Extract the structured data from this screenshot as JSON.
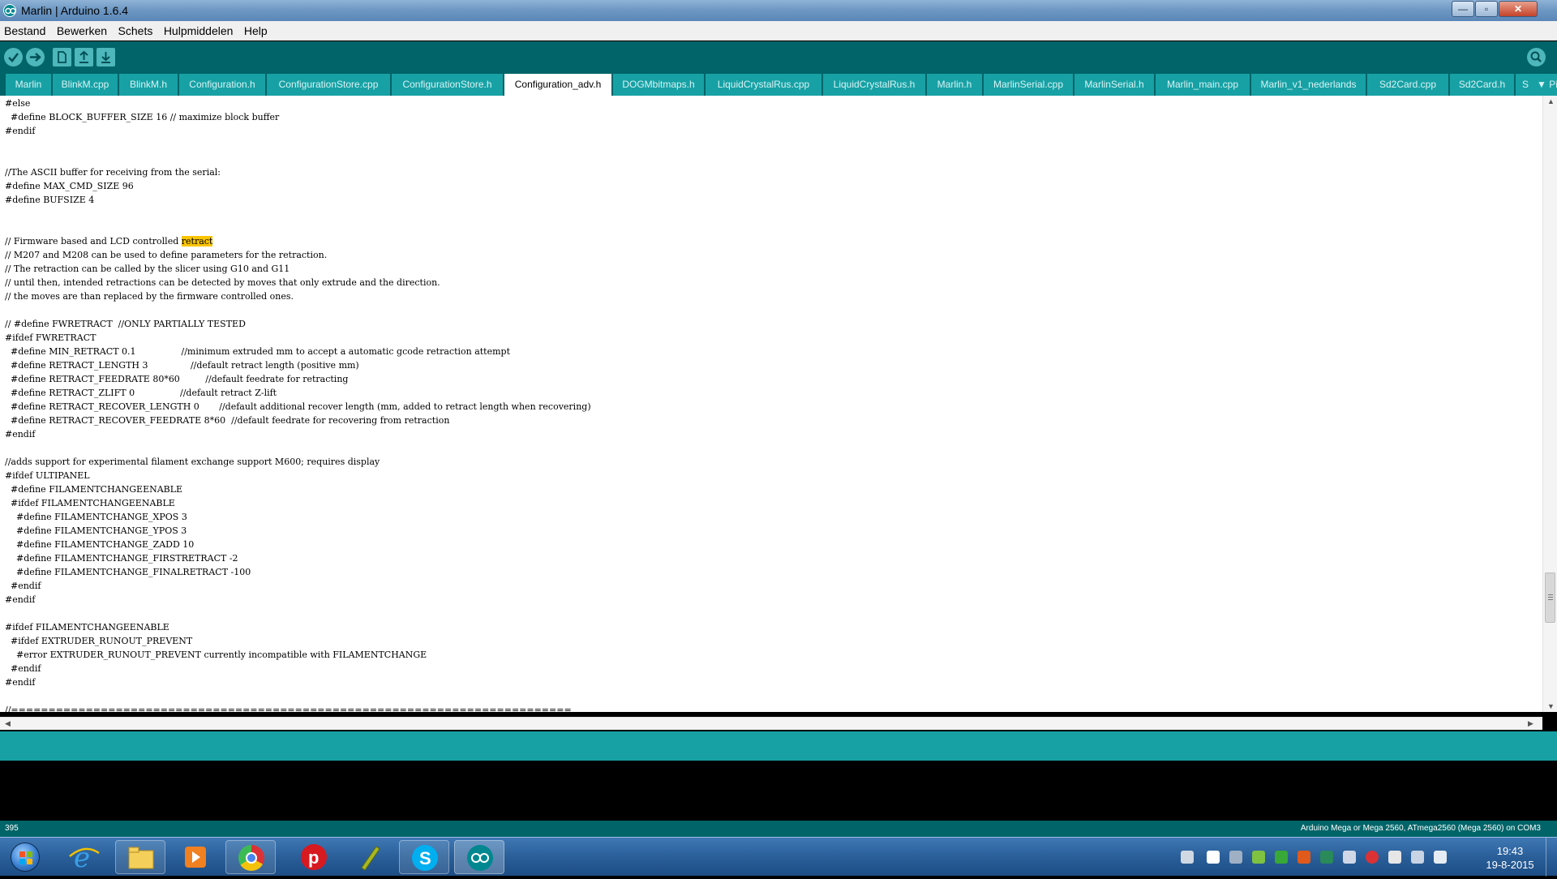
{
  "window": {
    "title": "Marlin | Arduino 1.6.4",
    "minimize": "—",
    "maximize": "▫",
    "close": "✕"
  },
  "menu": [
    "Bestand",
    "Bewerken",
    "Schets",
    "Hulpmiddelen",
    "Help"
  ],
  "toolbar": {
    "buttons": [
      "verify-icon",
      "upload-icon",
      "new-icon",
      "open-icon",
      "save-icon",
      "serial-monitor-icon"
    ],
    "accent": "#006468",
    "button_color": "#4db7bb"
  },
  "tabs": [
    "Marlin",
    "BlinkM.cpp",
    "BlinkM.h",
    "Configuration.h",
    "ConfigurationStore.cpp",
    "ConfigurationStore.h",
    "Configuration_adv.h",
    "DOGMbitmaps.h",
    "LiquidCrystalRus.cpp",
    "LiquidCrystalRus.h",
    "Marlin.h",
    "MarlinSerial.cpp",
    "MarlinSerial.h",
    "Marlin_main.cpp",
    "Marlin_v1_nederlands",
    "Sd2Card.cpp",
    "Sd2Card.h",
    "S"
  ],
  "active_tab": "Configuration_adv.h",
  "tab_menu": "▼ Pi",
  "code": [
    "#else",
    "  #define BLOCK_BUFFER_SIZE 16 // maximize block buffer",
    "#endif",
    "",
    "",
    "//The ASCII buffer for receiving from the serial:",
    "#define MAX_CMD_SIZE 96",
    "#define BUFSIZE 4",
    "",
    "",
    "// Firmware based and LCD controlled |retract|",
    "// M207 and M208 can be used to define parameters for the retraction.",
    "// The retraction can be called by the slicer using G10 and G11",
    "// until then, intended retractions can be detected by moves that only extrude and the direction.",
    "// the moves are than replaced by the firmware controlled ones.",
    "",
    "// #define FWRETRACT  //ONLY PARTIALLY TESTED",
    "#ifdef FWRETRACT",
    "  #define MIN_RETRACT 0.1                //minimum extruded mm to accept a automatic gcode retraction attempt",
    "  #define RETRACT_LENGTH 3               //default retract length (positive mm)",
    "  #define RETRACT_FEEDRATE 80*60         //default feedrate for retracting",
    "  #define RETRACT_ZLIFT 0                //default retract Z-lift",
    "  #define RETRACT_RECOVER_LENGTH 0       //default additional recover length (mm, added to retract length when recovering)",
    "  #define RETRACT_RECOVER_FEEDRATE 8*60  //default feedrate for recovering from retraction",
    "#endif",
    "",
    "//adds support for experimental filament exchange support M600; requires display",
    "#ifdef ULTIPANEL",
    "  #define FILAMENTCHANGEENABLE",
    "  #ifdef FILAMENTCHANGEENABLE",
    "    #define FILAMENTCHANGE_XPOS 3",
    "    #define FILAMENTCHANGE_YPOS 3",
    "    #define FILAMENTCHANGE_ZADD 10",
    "    #define FILAMENTCHANGE_FIRSTRETRACT -2",
    "    #define FILAMENTCHANGE_FINALRETRACT -100",
    "  #endif",
    "#endif",
    "",
    "#ifdef FILAMENTCHANGEENABLE",
    "  #ifdef EXTRUDER_RUNOUT_PREVENT",
    "    #error EXTRUDER_RUNOUT_PREVENT currently incompatible with FILAMENTCHANGE",
    "  #endif",
    "#endif",
    "",
    "//==========================================================================="
  ],
  "highlight_color": "#f9c400",
  "footer": {
    "line_number": "395",
    "board": "Arduino Mega or Mega 2560, ATmega2560 (Mega 2560) on COM3"
  },
  "taskbar": {
    "apps": [
      "internet-explorer-icon",
      "file-explorer-icon",
      "media-player-icon",
      "chrome-icon",
      "p-app-icon",
      "pencil-app-icon",
      "skype-icon",
      "arduino-icon"
    ],
    "clock_time": "19:43",
    "clock_date": "19-8-2015"
  }
}
